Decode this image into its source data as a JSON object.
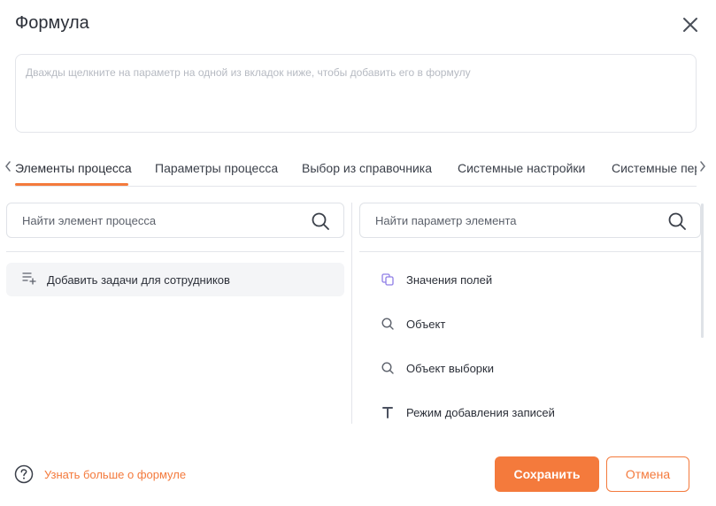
{
  "dialog": {
    "title": "Формула",
    "close_icon": "close-icon"
  },
  "formula": {
    "placeholder": "Дважды щелкните на параметр на одной из вкладок ниже, чтобы добавить его в формулу"
  },
  "tabs": [
    {
      "label": "Элементы процесса",
      "active": true
    },
    {
      "label": "Параметры процесса",
      "active": false
    },
    {
      "label": "Выбор из справочника",
      "active": false
    },
    {
      "label": "Системные настройки",
      "active": false
    },
    {
      "label": "Системные пер",
      "active": false
    }
  ],
  "left_panel": {
    "search_placeholder": "Найти элемент процесса",
    "items": [
      {
        "label": "Добавить задачи для сотрудников",
        "icon": "add-list-icon"
      }
    ]
  },
  "right_panel": {
    "search_placeholder": "Найти параметр элемента",
    "items": [
      {
        "label": "Значения полей",
        "icon": "copy-icon"
      },
      {
        "label": "Объект",
        "icon": "search-icon"
      },
      {
        "label": "Объект выборки",
        "icon": "search-icon"
      },
      {
        "label": "Режим добавления записей",
        "icon": "text-icon"
      }
    ]
  },
  "footer": {
    "help_link": "Узнать больше о формуле",
    "save_label": "Сохранить",
    "cancel_label": "Отмена"
  },
  "colors": {
    "accent": "#f47a3c",
    "text": "#2b2f38",
    "border": "#e3e5ea",
    "item_bg": "#f4f5f7",
    "icon_purple": "#8f7ee6"
  }
}
